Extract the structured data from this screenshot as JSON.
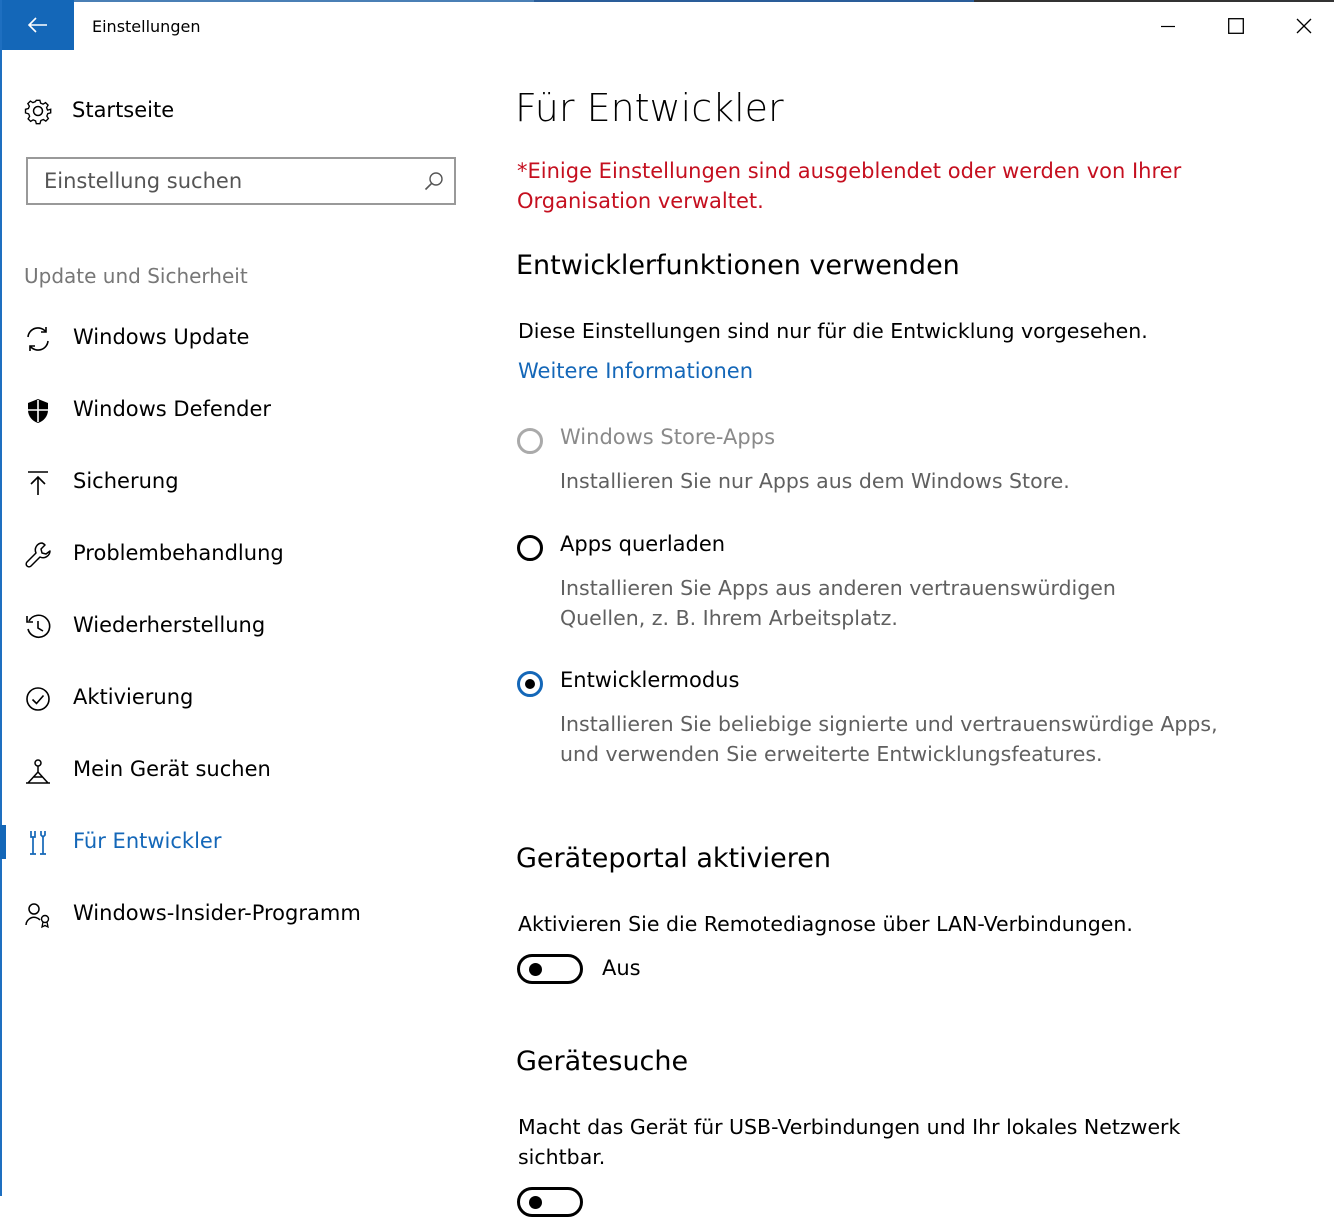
{
  "window": {
    "title": "Einstellungen",
    "accent_color": "#1467b8",
    "back_icon": "back-arrow-icon",
    "controls": [
      "minimize-icon",
      "maximize-icon",
      "close-icon"
    ]
  },
  "sidebar": {
    "home_label": "Startseite",
    "search_placeholder": "Einstellung suchen",
    "section_title": "Update und Sicherheit",
    "items": [
      {
        "label": "Windows Update",
        "icon": "refresh-icon"
      },
      {
        "label": "Windows Defender",
        "icon": "shield-icon"
      },
      {
        "label": "Sicherung",
        "icon": "upload-arrow-icon"
      },
      {
        "label": "Problembehandlung",
        "icon": "wrench-icon"
      },
      {
        "label": "Wiederherstellung",
        "icon": "history-icon"
      },
      {
        "label": "Aktivierung",
        "icon": "checkmark-circle-icon"
      },
      {
        "label": "Mein Gerät suchen",
        "icon": "find-device-icon"
      },
      {
        "label": "Für Entwickler",
        "icon": "developer-tools-icon",
        "active": true
      },
      {
        "label": "Windows-Insider-Programm",
        "icon": "insider-icon"
      }
    ]
  },
  "main": {
    "title": "Für Entwickler",
    "warning": "*Einige Einstellungen sind ausgeblendet oder werden von Ihrer Organisation verwaltet.",
    "warning_color": "#c50f1f",
    "dev_features": {
      "heading": "Entwicklerfunktionen verwenden",
      "description": "Diese Einstellungen sind nur für die Entwicklung vorgesehen.",
      "link": "Weitere Informationen",
      "options": [
        {
          "label": "Windows Store-Apps",
          "description": "Installieren Sie nur Apps aus dem Windows Store.",
          "disabled": true,
          "checked": false
        },
        {
          "label": "Apps querladen",
          "description": "Installieren Sie Apps aus anderen vertrauenswürdigen Quellen, z. B. Ihrem Arbeitsplatz.",
          "disabled": false,
          "checked": false
        },
        {
          "label": "Entwicklermodus",
          "description": "Installieren Sie beliebige signierte und vertrauenswürdige Apps, und verwenden Sie erweiterte Entwicklungsfeatures.",
          "disabled": false,
          "checked": true
        }
      ]
    },
    "device_portal": {
      "heading": "Geräteportal aktivieren",
      "description": "Aktivieren Sie die Remotediagnose über LAN-Verbindungen.",
      "toggle_state": "Aus"
    },
    "device_discovery": {
      "heading": "Gerätesuche",
      "description": "Macht das Gerät für USB-Verbindungen und Ihr lokales Netzwerk sichtbar."
    }
  }
}
